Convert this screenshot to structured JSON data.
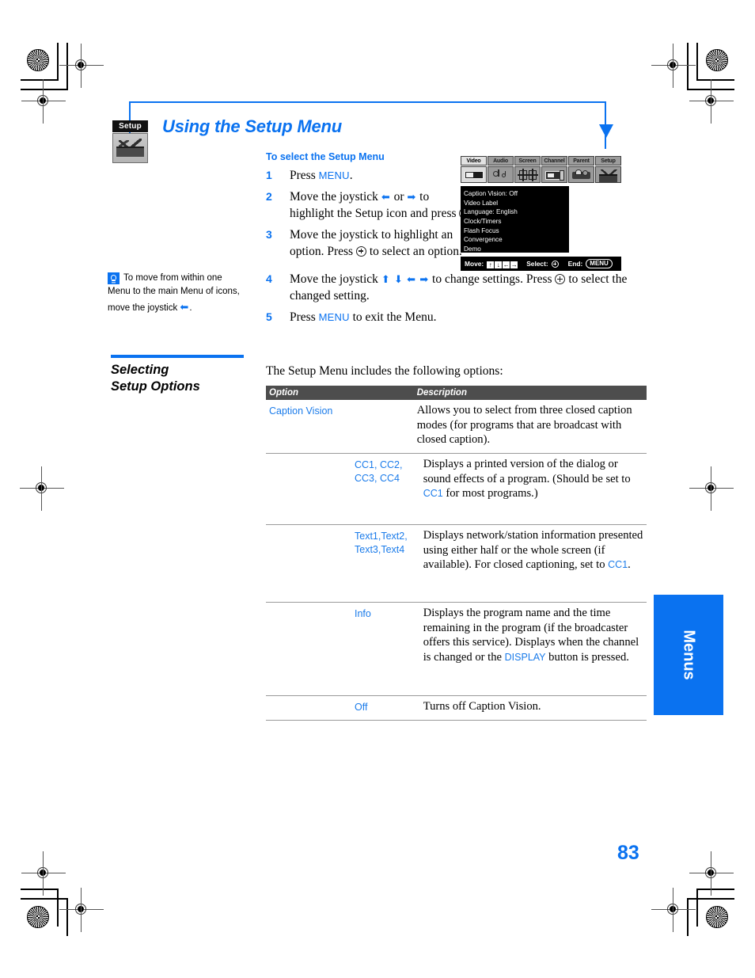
{
  "page": {
    "title": "Using the Setup Menu",
    "number": "83",
    "side_tab": "Menus",
    "badge_label": "Setup"
  },
  "procedure": {
    "heading": "To select the Setup Menu",
    "steps": [
      {
        "num": "1",
        "parts": [
          "Press ",
          "MENU",
          "."
        ]
      },
      {
        "num": "2",
        "parts": [
          "Move the joystick ",
          "⬅",
          " or ",
          "➡",
          " to highlight the Setup icon and press ",
          "⊙",
          "."
        ]
      },
      {
        "num": "3",
        "parts": [
          "Move the joystick to highlight an option. Press ",
          "⊙",
          " to select an option."
        ]
      },
      {
        "num": "4",
        "parts": [
          "Move the joystick ",
          "⬆ ⬇ ⬅ ➡",
          " to change settings. Press ",
          "⊙",
          " to select the changed setting."
        ]
      },
      {
        "num": "5",
        "parts": [
          "Press ",
          "MENU",
          " to exit the Menu."
        ]
      }
    ],
    "step1_pre": "Press ",
    "step1_key": "MENU",
    "step1_post": ".",
    "step2_pre": "Move the joystick ",
    "step2_mid": " or ",
    "step2_post": " to highlight the Setup icon and press ",
    "step2_end": ".",
    "step3_pre": "Move the joystick to highlight an option. Press ",
    "step3_post": " to select an option.",
    "step4_pre": "Move the joystick ",
    "step4_mid": " to change settings. Press ",
    "step4_post": " to select the changed setting.",
    "step5_pre": "Press ",
    "step5_key": "MENU",
    "step5_post": " to exit the Menu."
  },
  "tip": {
    "text": "To move from within one Menu to the main Menu of icons, move the joystick",
    "arrow": "⬅",
    "period": "."
  },
  "section": {
    "title_line1": "Selecting",
    "title_line2": "Setup Options"
  },
  "tv_menu": {
    "tabs": [
      "Video",
      "Audio",
      "Screen",
      "Channel",
      "Parent",
      "Setup"
    ],
    "selected_tab": "Setup",
    "screen_items": [
      "Caption Vision: Off",
      "Video Label",
      "Language: English",
      "Clock/Timers",
      "Flash Focus",
      "Convergence",
      "Demo"
    ],
    "footer": {
      "move_label": "Move:",
      "move_keys": [
        "↑",
        "↓",
        "←",
        "→"
      ],
      "select_label": "Select:",
      "end_label": "End:",
      "end_key": "MENU"
    }
  },
  "table": {
    "intro": "The Setup Menu includes the following options:",
    "headers": {
      "option": "Option",
      "description": "Description"
    },
    "rows": [
      {
        "option": "Caption Vision",
        "desc_plain": "Allows you to select from three closed caption modes (for programs that are broadcast with closed caption)."
      },
      {
        "option_line1": "CC1, CC2,",
        "option_line2": "CC3, CC4",
        "desc_a": "Displays a printed version of the dialog or sound effects of a program. (Should be set to ",
        "desc_link": "CC1",
        "desc_b": " for most programs.)"
      },
      {
        "option_line1": "Text1,Text2,",
        "option_line2": "Text3,Text4",
        "desc_a": "Displays network/station information presented using either half or the whole screen (if available). For closed captioning, set to ",
        "desc_link": "CC1",
        "desc_b": "."
      },
      {
        "option_line1": "Info",
        "option_line2": "",
        "desc_a": "Displays the program name and the time remaining in the program (if the broadcaster offers this service). Displays when the channel is changed or the ",
        "desc_link": "DISPLAY",
        "desc_b": " button is pressed."
      },
      {
        "option_line1": "Off",
        "option_line2": "",
        "desc_a": "Turns off Caption Vision.",
        "desc_link": "",
        "desc_b": ""
      }
    ]
  },
  "colors": {
    "accent": "#0a72f0",
    "link": "#1a7bea",
    "table_header_bg": "#4d4d4d"
  }
}
